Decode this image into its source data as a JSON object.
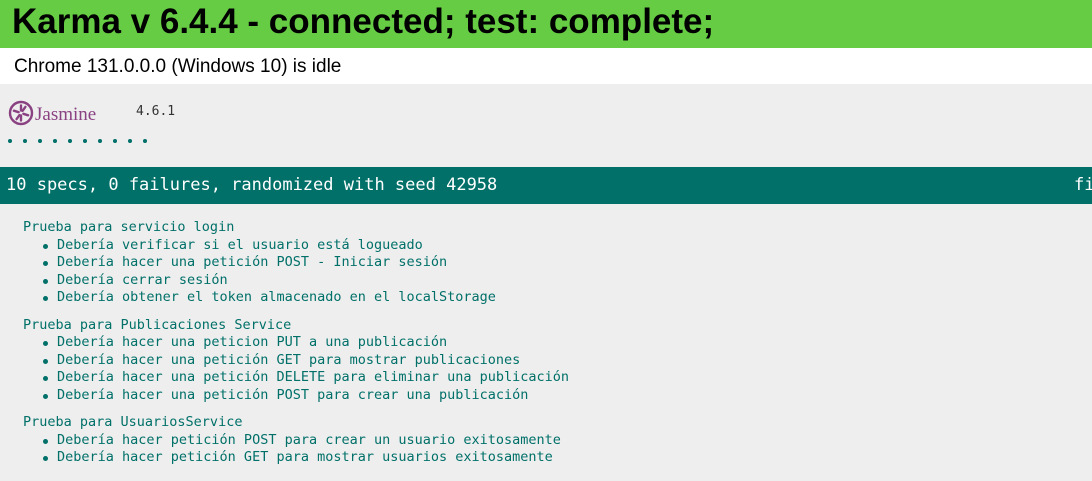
{
  "banner": {
    "title": "Karma v 6.4.4 - connected; test: complete;"
  },
  "browsers": [
    {
      "status": "Chrome 131.0.0.0 (Windows 10) is idle"
    }
  ],
  "jasmine": {
    "logo_text": "Jasmine",
    "version": "4.6.1",
    "passed_symbol_count": 10
  },
  "summary": {
    "text": "10 specs, 0 failures, randomized with seed 42958",
    "options_label": "fi"
  },
  "colors": {
    "banner": "#66cc44",
    "summary_bar": "#007069",
    "spec_text": "#007069",
    "logo": "#8a4182"
  },
  "suites": [
    {
      "title": "Prueba para servicio login",
      "specs": [
        "Debería verificar si el usuario está logueado",
        "Debería hacer una petición POST - Iniciar sesión",
        "Debería cerrar sesión",
        "Debería obtener el token almacenado en el localStorage"
      ]
    },
    {
      "title": "Prueba para Publicaciones Service",
      "specs": [
        "Debería hacer una peticion PUT a una publicación",
        "Debería hacer una petición GET para mostrar publicaciones",
        "Debería hacer una petición DELETE para eliminar una publicación",
        "Debería hacer una petición POST para crear una publicación"
      ]
    },
    {
      "title": "Prueba para UsuariosService",
      "specs": [
        "Debería hacer petición POST para crear un usuario exitosamente",
        "Debería hacer petición GET para mostrar usuarios exitosamente"
      ]
    }
  ]
}
